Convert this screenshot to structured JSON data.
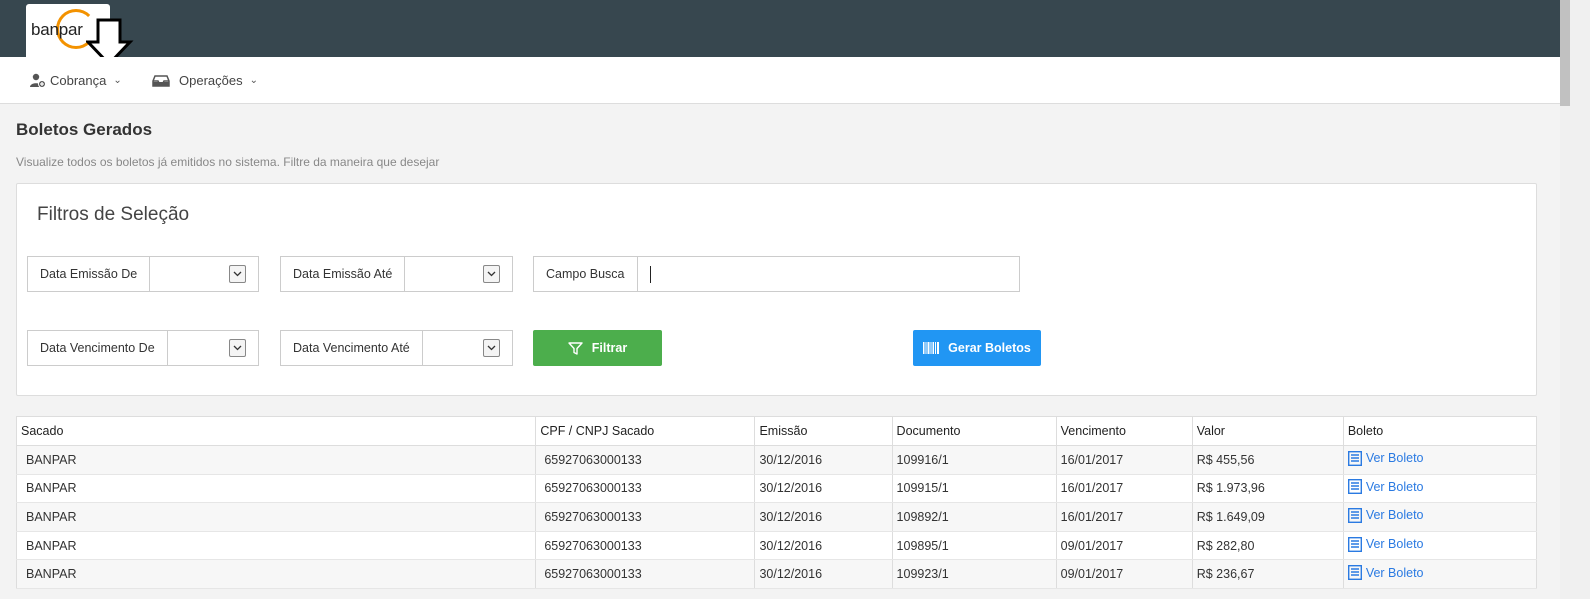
{
  "app": {
    "logo_text": "banpar"
  },
  "nav": {
    "items": [
      {
        "label": "Cobrança",
        "icon": "user-add-icon"
      },
      {
        "label": "Operações",
        "icon": "tray-icon"
      }
    ]
  },
  "page": {
    "title": "Boletos Gerados",
    "subtitle": "Visualize todos os boletos já emitidos no sistema. Filtre da maneira que desejar"
  },
  "filters": {
    "title": "Filtros de Seleção",
    "emissao_de": "Data Emissão De",
    "emissao_ate": "Data Emissão Até",
    "campo_busca": "Campo Busca",
    "vencimento_de": "Data Vencimento De",
    "vencimento_ate": "Data Vencimento Até",
    "filtrar_label": "Filtrar",
    "gerar_label": "Gerar Boletos"
  },
  "table": {
    "headers": [
      "Sacado",
      "CPF / CNPJ Sacado",
      "Emissão",
      "Documento",
      "Vencimento",
      "Valor",
      "Boleto"
    ],
    "rows": [
      {
        "sacado": "BANPAR",
        "cpf": "65927063000133",
        "emissao": "30/12/2016",
        "documento": "109916/1",
        "vencimento": "16/01/2017",
        "valor": "R$ 455,56",
        "link": "Ver Boleto"
      },
      {
        "sacado": "BANPAR",
        "cpf": "65927063000133",
        "emissao": "30/12/2016",
        "documento": "109915/1",
        "vencimento": "16/01/2017",
        "valor": "R$ 1.973,96",
        "link": "Ver Boleto"
      },
      {
        "sacado": "BANPAR",
        "cpf": "65927063000133",
        "emissao": "30/12/2016",
        "documento": "109892/1",
        "vencimento": "16/01/2017",
        "valor": "R$ 1.649,09",
        "link": "Ver Boleto"
      },
      {
        "sacado": "BANPAR",
        "cpf": "65927063000133",
        "emissao": "30/12/2016",
        "documento": "109895/1",
        "vencimento": "09/01/2017",
        "valor": "R$ 282,80",
        "link": "Ver Boleto"
      },
      {
        "sacado": "BANPAR",
        "cpf": "65927063000133",
        "emissao": "30/12/2016",
        "documento": "109923/1",
        "vencimento": "09/01/2017",
        "valor": "R$ 236,67",
        "link": "Ver Boleto"
      }
    ]
  }
}
